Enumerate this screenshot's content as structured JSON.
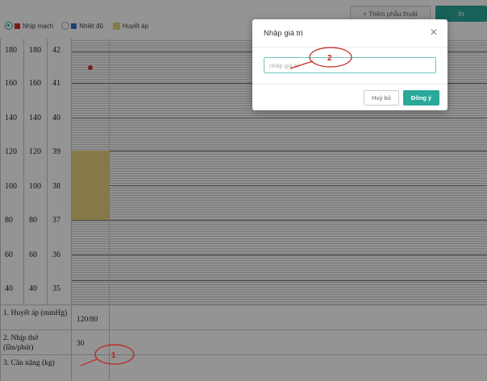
{
  "legend": {
    "items": [
      {
        "label": "Nhịp mạch",
        "color": "#d9302a",
        "selected": true
      },
      {
        "label": "Nhiệt độ",
        "color": "#2d6fcc",
        "selected": false
      },
      {
        "label": "Huyết áp",
        "color": "#e8d07a",
        "selected": false
      }
    ]
  },
  "toolbar": {
    "add_surgery_label": "+ Thêm phẫu thuật",
    "print_label": "In"
  },
  "scale": {
    "rows": [
      {
        "pulse": "180",
        "bp": "180",
        "temp": "42"
      },
      {
        "pulse": "160",
        "bp": "160",
        "temp": "41"
      },
      {
        "pulse": "140",
        "bp": "140",
        "temp": "40"
      },
      {
        "pulse": "120",
        "bp": "120",
        "temp": "39"
      },
      {
        "pulse": "100",
        "bp": "100",
        "temp": "38"
      },
      {
        "pulse": "80",
        "bp": "80",
        "temp": "37"
      },
      {
        "pulse": "60",
        "bp": "60",
        "temp": "36"
      },
      {
        "pulse": "40",
        "bp": "40",
        "temp": "35"
      }
    ]
  },
  "vitals": {
    "rows": [
      {
        "label": "1. Huyết áp (mmHg)",
        "value": "120/80"
      },
      {
        "label": "2. Nhịp thở (lần/phút)",
        "value": "30"
      },
      {
        "label": "3. Cân nặng (kg)",
        "value": ""
      }
    ]
  },
  "modal": {
    "title": "Nhập giá trị",
    "input_placeholder": "nhập giá trị",
    "input_value": "",
    "cancel_label": "Huỷ bỏ",
    "ok_label": "Đồng ý",
    "close_icon": "close-icon"
  },
  "annotations": {
    "marker_1": "1",
    "marker_2": "2"
  },
  "colors": {
    "accent": "#2aa89a",
    "pulse_dot": "#d9302a",
    "bp_fill": "#e8d07a",
    "annotation": "#c0201a"
  }
}
